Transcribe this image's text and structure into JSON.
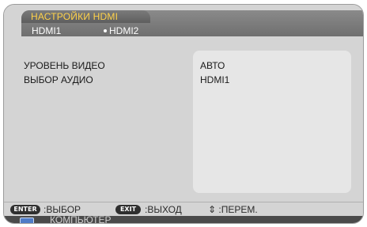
{
  "menu": {
    "title": "НАСТРОЙКИ HDMI",
    "subtabs": [
      {
        "label": "HDMI1",
        "selected": false
      },
      {
        "label": "HDMI2",
        "selected": true
      }
    ]
  },
  "settings": [
    {
      "label": "УРОВЕНЬ ВИДЕО",
      "value": "АВТО"
    },
    {
      "label": "ВЫБОР АУДИО",
      "value": "HDMI1"
    }
  ],
  "footer": {
    "enter_key": "ENTER",
    "enter_hint": ":ВЫБОР",
    "exit_key": "EXIT",
    "exit_hint": ":ВЫХОД",
    "move_symbol": "⇕",
    "move_hint": ":ПЕРЕМ."
  },
  "source": {
    "icon": "monitor-icon",
    "label": "КОМПЬЮТЕР"
  },
  "colors": {
    "title_color": "#ffd24a",
    "panel_bg": "#d4d4d4",
    "value_panel_bg": "#e6e6e6",
    "header_bg": "#7a7a7a"
  }
}
